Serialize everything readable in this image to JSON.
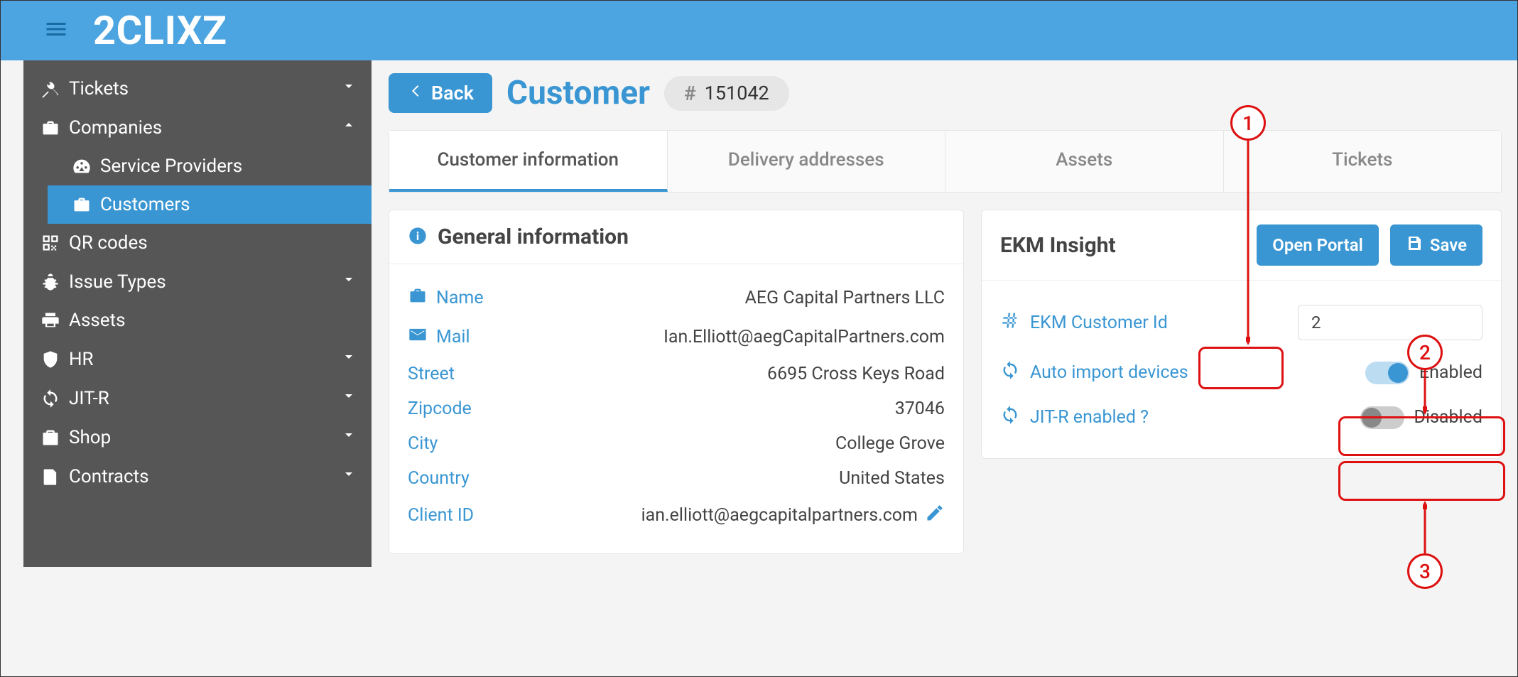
{
  "app": {
    "logo": "2CLIXZ"
  },
  "sidebar": {
    "items": [
      {
        "label": "Tickets"
      },
      {
        "label": "Companies"
      },
      {
        "label": "Service Providers"
      },
      {
        "label": "Customers"
      },
      {
        "label": "QR codes"
      },
      {
        "label": "Issue Types"
      },
      {
        "label": "Assets"
      },
      {
        "label": "HR"
      },
      {
        "label": "JIT-R"
      },
      {
        "label": "Shop"
      },
      {
        "label": "Contracts"
      }
    ]
  },
  "header": {
    "back": "Back",
    "title": "Customer",
    "id": "151042"
  },
  "tabs": {
    "t0": "Customer information",
    "t1": "Delivery addresses",
    "t2": "Assets",
    "t3": "Tickets"
  },
  "general": {
    "title": "General information",
    "name_label": "Name",
    "name_value": "AEG Capital Partners LLC",
    "mail_label": "Mail",
    "mail_value": "Ian.Elliott@aegCapitalPartners.com",
    "street_label": "Street",
    "street_value": "6695 Cross Keys Road",
    "zip_label": "Zipcode",
    "zip_value": "37046",
    "city_label": "City",
    "city_value": "College Grove",
    "country_label": "Country",
    "country_value": "United States",
    "clientid_label": "Client ID",
    "clientid_value": "ian.elliott@aegcapitalpartners.com"
  },
  "ekm": {
    "title": "EKM Insight",
    "open_portal": "Open Portal",
    "save": "Save",
    "custid_label": "EKM Customer Id",
    "custid_value": "2",
    "autoimport_label": "Auto import devices",
    "autoimport_status": "Enabled",
    "jitr_label": "JIT-R enabled ?",
    "jitr_status": "Disabled"
  },
  "callouts": {
    "c1": "1",
    "c2": "2",
    "c3": "3"
  }
}
